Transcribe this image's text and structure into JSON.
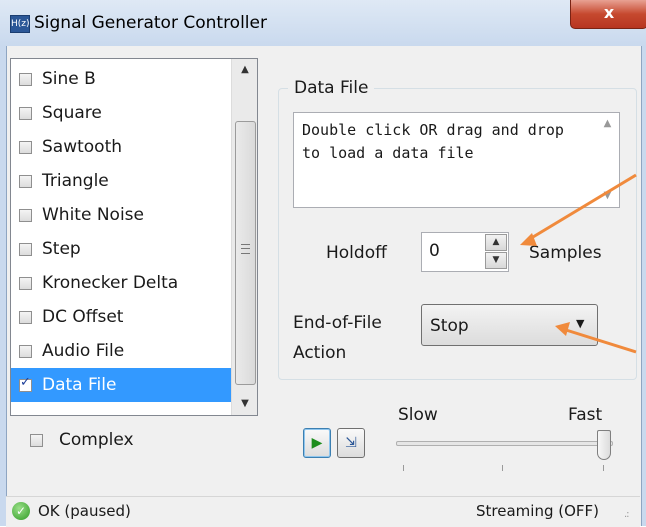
{
  "window": {
    "title": "Signal Generator Controller",
    "close_label": "x",
    "app_icon": "H(z)"
  },
  "signal_list": {
    "items": [
      {
        "label": "Sine B",
        "checked": false
      },
      {
        "label": "Square",
        "checked": false
      },
      {
        "label": "Sawtooth",
        "checked": false
      },
      {
        "label": "Triangle",
        "checked": false
      },
      {
        "label": "White Noise",
        "checked": false
      },
      {
        "label": "Step",
        "checked": false
      },
      {
        "label": "Kronecker Delta",
        "checked": false
      },
      {
        "label": "DC Offset",
        "checked": false
      },
      {
        "label": "Audio File",
        "checked": false
      },
      {
        "label": "Data File",
        "checked": true,
        "selected": true
      }
    ]
  },
  "complex": {
    "label": "Complex",
    "checked": false
  },
  "data_file_group": {
    "title": "Data File",
    "text": "Double click OR drag and drop to load a data file",
    "holdoff_label": "Holdoff",
    "holdoff_value": "0",
    "samples_label": "Samples",
    "eof_label": "End-of-File Action",
    "eof_value": "Stop"
  },
  "speed": {
    "slow_label": "Slow",
    "fast_label": "Fast",
    "level": 1.0
  },
  "status": {
    "left": "OK (paused)",
    "right": "Streaming (OFF)"
  },
  "colors": {
    "selection": "#3399ff",
    "annotation_arrow": "#f08a3c",
    "status_ok": "#2e9a23"
  },
  "icons": [
    "app-icon",
    "close-icon",
    "play-icon",
    "step-icon",
    "ok-status-icon",
    "resize-grip-icon"
  ]
}
